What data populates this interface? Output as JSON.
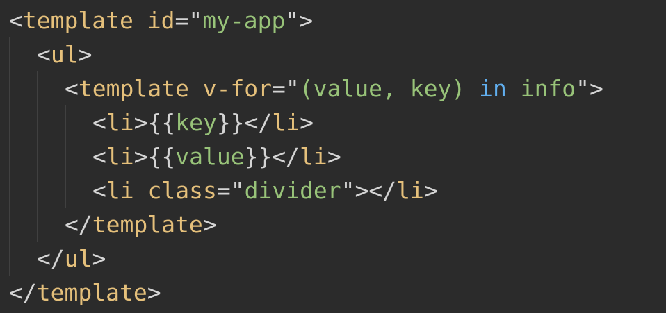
{
  "colors": {
    "background": "#2b2b2b",
    "punctuation": "#d4d4d4",
    "tag": "#e5c07b",
    "string": "#98c379",
    "keyword": "#61afef"
  },
  "lines": [
    {
      "indent": 0,
      "tokens": [
        {
          "t": "<",
          "c": "punct"
        },
        {
          "t": "template",
          "c": "tag"
        },
        {
          "t": " ",
          "c": "punct"
        },
        {
          "t": "id",
          "c": "attr"
        },
        {
          "t": "=\"",
          "c": "punct"
        },
        {
          "t": "my-app",
          "c": "str"
        },
        {
          "t": "\">",
          "c": "punct"
        }
      ]
    },
    {
      "indent": 1,
      "tokens": [
        {
          "t": "<",
          "c": "punct"
        },
        {
          "t": "ul",
          "c": "tag"
        },
        {
          "t": ">",
          "c": "punct"
        }
      ]
    },
    {
      "indent": 2,
      "tokens": [
        {
          "t": "<",
          "c": "punct"
        },
        {
          "t": "template",
          "c": "tag"
        },
        {
          "t": " ",
          "c": "punct"
        },
        {
          "t": "v-for",
          "c": "attr"
        },
        {
          "t": "=\"",
          "c": "punct"
        },
        {
          "t": "(value, key) ",
          "c": "str"
        },
        {
          "t": "in",
          "c": "kw"
        },
        {
          "t": " info",
          "c": "str"
        },
        {
          "t": "\">",
          "c": "punct"
        }
      ]
    },
    {
      "indent": 3,
      "tokens": [
        {
          "t": "<",
          "c": "punct"
        },
        {
          "t": "li",
          "c": "tag"
        },
        {
          "t": ">{{",
          "c": "punct"
        },
        {
          "t": "key",
          "c": "expr"
        },
        {
          "t": "}}</",
          "c": "punct"
        },
        {
          "t": "li",
          "c": "tag"
        },
        {
          "t": ">",
          "c": "punct"
        }
      ]
    },
    {
      "indent": 3,
      "tokens": [
        {
          "t": "<",
          "c": "punct"
        },
        {
          "t": "li",
          "c": "tag"
        },
        {
          "t": ">{{",
          "c": "punct"
        },
        {
          "t": "value",
          "c": "expr"
        },
        {
          "t": "}}</",
          "c": "punct"
        },
        {
          "t": "li",
          "c": "tag"
        },
        {
          "t": ">",
          "c": "punct"
        }
      ]
    },
    {
      "indent": 3,
      "tokens": [
        {
          "t": "<",
          "c": "punct"
        },
        {
          "t": "li",
          "c": "tag"
        },
        {
          "t": " ",
          "c": "punct"
        },
        {
          "t": "class",
          "c": "attr"
        },
        {
          "t": "=\"",
          "c": "punct"
        },
        {
          "t": "divider",
          "c": "str"
        },
        {
          "t": "\"></",
          "c": "punct"
        },
        {
          "t": "li",
          "c": "tag"
        },
        {
          "t": ">",
          "c": "punct"
        }
      ]
    },
    {
      "indent": 2,
      "tokens": [
        {
          "t": "</",
          "c": "punct"
        },
        {
          "t": "template",
          "c": "tag"
        },
        {
          "t": ">",
          "c": "punct"
        }
      ]
    },
    {
      "indent": 1,
      "tokens": [
        {
          "t": "</",
          "c": "punct"
        },
        {
          "t": "ul",
          "c": "tag"
        },
        {
          "t": ">",
          "c": "punct"
        }
      ]
    },
    {
      "indent": 0,
      "tokens": [
        {
          "t": "</",
          "c": "punct"
        },
        {
          "t": "template",
          "c": "tag"
        },
        {
          "t": ">",
          "c": "punct"
        }
      ]
    }
  ]
}
